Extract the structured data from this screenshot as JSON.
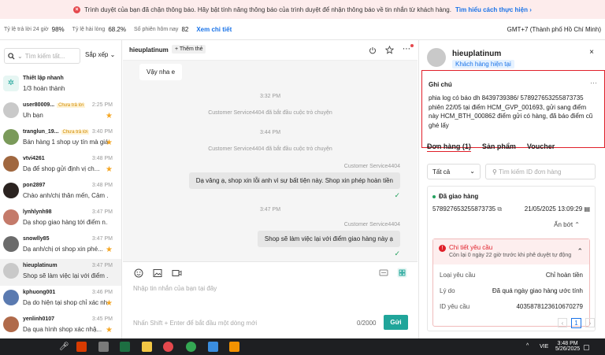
{
  "banner": {
    "text": "Trình duyệt của bạn đã chặn thông báo. Hãy bật tính năng thông báo của trình duyệt để nhận thông báo về tin nhắn từ khách hàng.",
    "link": "Tìm hiểu cách thực hiện",
    "link_arrow": "›"
  },
  "stats": {
    "items": [
      {
        "label": "Tỷ lệ trả lời 24 giờ",
        "value": "98%"
      },
      {
        "label": "Tỷ lệ hài lòng",
        "value": "68.2%"
      },
      {
        "label": "Số phiên hôm nay",
        "value": "82"
      }
    ],
    "details_link": "Xem chi tiết",
    "timezone": "GMT+7 (Thành phố Hồ Chí Minh)"
  },
  "left": {
    "search_placeholder": "Tìm kiếm tất...",
    "sort_label": "Sắp xếp",
    "quick_setup": {
      "title": "Thiết lập nhanh",
      "progress": "1/3 hoàn thành"
    },
    "conversations": [
      {
        "name": "user80009...",
        "tag": "Chưa trả lời",
        "time": "2:25 PM",
        "msg": "Uh bạn",
        "star": true,
        "avatar": "#c9c9c9"
      },
      {
        "name": "tranglun_19...",
        "tag": "Chưa trả lời",
        "time": "3:40 PM",
        "msg": "Bán hàng 1 shop uy tín mà giá...",
        "star": true,
        "avatar": "#7a9a5a"
      },
      {
        "name": "vtvi4261",
        "tag": "",
        "time": "3:48 PM",
        "msg": "Dạ để shop gửi định vị ch...",
        "star": true,
        "avatar": "#a0673f"
      },
      {
        "name": "pon2897",
        "tag": "",
        "time": "3:48 PM",
        "msg": "Chào anh/chị thân mến, Cảm ...",
        "star": false,
        "avatar": "#2b2320"
      },
      {
        "name": "lynhlynh98",
        "tag": "",
        "time": "3:47 PM",
        "msg": "Dạ shop giao hàng tới điểm n...",
        "star": false,
        "avatar": "#c47a6a"
      },
      {
        "name": "snowlly85",
        "tag": "",
        "time": "3:47 PM",
        "msg": "Dạ anh/chị ơi shop xin phé...",
        "star": true,
        "avatar": "#6b6b6b"
      },
      {
        "name": "hieuplatinum",
        "tag": "",
        "time": "3:47 PM",
        "msg": "Shop sẽ làm việc lại với điểm ...",
        "star": false,
        "avatar": "#c9c9c9"
      },
      {
        "name": "kphuong001",
        "tag": "",
        "time": "3:46 PM",
        "msg": "Dạ do hiện tại shop chỉ xác nh...",
        "star": true,
        "avatar": "#5a7ab0"
      },
      {
        "name": "yenlinh0107",
        "tag": "",
        "time": "3:45 PM",
        "msg": "Dạ qua hình shop xác nhậ...",
        "star": true,
        "avatar": "#b06a4a"
      }
    ]
  },
  "chat": {
    "username": "hieuplatinum",
    "add_tag": "+ Thêm thẻ",
    "incoming": "Vậy nha e",
    "time1": "3:32 PM",
    "sys1": "Customer Service4404 đã bắt đầu cuộc trò chuyện",
    "time2": "3:44 PM",
    "sys2": "Customer Service4404 đã bắt đầu cuộc trò chuyện",
    "sender1": "Customer Service4404",
    "out1": "Dạ vâng ạ, shop xin lỗi anh vì sự bất tiện này. Shop xin phép hoàn tiền",
    "time3": "3:47 PM",
    "sender2": "Customer Service4404",
    "out2": "Shop sẽ làm việc lại với điểm giao hàng này ạ",
    "check": "✓",
    "input_placeholder": "Nhập tin nhắn của bạn tại đây",
    "hint": "Nhấn Shift + Enter để bắt đầu một dòng mới",
    "counter": "0/2000",
    "send": "Gửi"
  },
  "right": {
    "name": "hieuplatinum",
    "customer_tag": "Khách hàng hiện tại",
    "close": "×",
    "note_title": "Ghi chú",
    "note_dots": "···",
    "note_text": "phia log có báo dh 8439739386/ 578927653255873735 phiên 22/05 tại điểm HCM_GVP_001693, gửi sang điểm này HCM_BTH_000862 điểm gửi có hàng, đã báo điểm cũ ghé lấy",
    "tabs": [
      "Đơn hàng (1)",
      "Sản phẩm",
      "Voucher"
    ],
    "filter": "Tất cả",
    "order_search": "Tìm kiếm ID đơn hàng",
    "order": {
      "status": "Đã giao hàng",
      "id": "578927653255873735",
      "date": "21/05/2025 13:09:29",
      "more": "Ẩn bớt",
      "req_title": "Chi tiết yêu cầu",
      "req_sub": "Còn lại 0 ngày 22 giờ trước khi phê duyệt tự động",
      "rows": [
        {
          "k": "Loại yêu cầu",
          "v": "Chỉ hoàn tiền"
        },
        {
          "k": "Lý do",
          "v": "Đã quá ngày giao hàng ước tính"
        },
        {
          "k": "ID yêu cầu",
          "v": "4035878123610670279"
        }
      ]
    },
    "page": "1"
  },
  "taskbar": {
    "lang": "VIE",
    "time": "3:48 PM",
    "date": "5/26/2025"
  }
}
